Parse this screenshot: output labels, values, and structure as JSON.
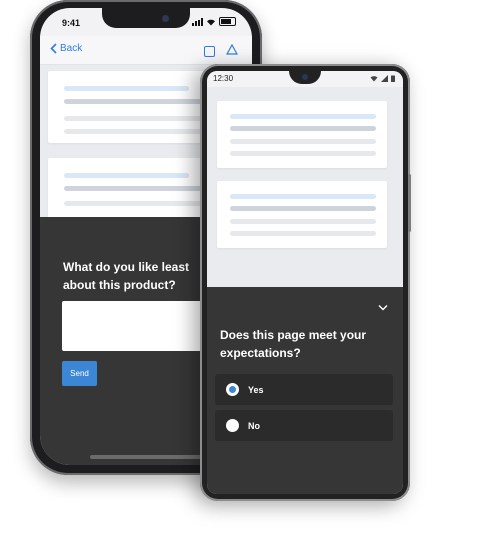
{
  "iphone": {
    "status_time": "9:41",
    "nav": {
      "back_label": "Back",
      "icons": [
        "square-icon",
        "triangle-icon"
      ]
    },
    "feedback": {
      "question": "What do you like least about this product?",
      "answer_value": "",
      "send_label": "Send"
    }
  },
  "android": {
    "status_time": "12:30",
    "survey": {
      "question": "Does this page meet your expectations?",
      "options": [
        {
          "label": "Yes",
          "selected": true
        },
        {
          "label": "No",
          "selected": false
        }
      ]
    }
  },
  "colors": {
    "accent": "#3b87d6",
    "panel_bg": "#363636",
    "option_bg": "#2b2b2b",
    "ios_link": "#2f7de1"
  }
}
